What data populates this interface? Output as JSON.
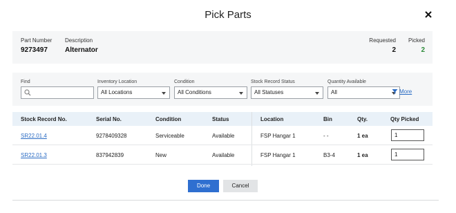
{
  "modal": {
    "title": "Pick Parts"
  },
  "part": {
    "part_number_label": "Part Number",
    "part_number": "9273497",
    "description_label": "Description",
    "description": "Alternator",
    "requested_label": "Requested",
    "requested": "2",
    "picked_label": "Picked",
    "picked": "2"
  },
  "filters": {
    "find_label": "Find",
    "find_value": "",
    "inventory_location_label": "Inventory Location",
    "inventory_location_value": "All Locations",
    "condition_label": "Condition",
    "condition_value": "All Conditions",
    "stock_status_label": "Stock Record Status",
    "stock_status_value": "All Statuses",
    "quantity_available_label": "Quantity Available",
    "quantity_available_value": "All",
    "more_label": "More"
  },
  "table": {
    "headers": {
      "stock_record": "Stock Record No.",
      "serial": "Serial No.",
      "condition": "Condition",
      "status": "Status",
      "location": "Location",
      "bin": "Bin",
      "qty": "Qty.",
      "qty_picked": "Qty Picked"
    },
    "rows": [
      {
        "stock_record": "SR22.01.4",
        "serial": "9278409328",
        "condition": "Serviceable",
        "status": "Available",
        "location": "FSP Hangar 1",
        "bin": "- -",
        "qty": "1 ea",
        "qty_picked": "1"
      },
      {
        "stock_record": "SR22.01.3",
        "serial": "837942839",
        "condition": "New",
        "status": "Available",
        "location": "FSP Hangar 1",
        "bin": "B3-4",
        "qty": "1 ea",
        "qty_picked": "1"
      }
    ]
  },
  "actions": {
    "done_label": "Done",
    "cancel_label": "Cancel"
  },
  "colors": {
    "accent": "#2f6fd0",
    "link": "#2b6cc4",
    "picked_green": "#2e8b3a",
    "header_bg": "#e9f1f8"
  },
  "icons": [
    "close-icon",
    "search-icon",
    "dropdown-caret-icon",
    "filter-icon"
  ]
}
